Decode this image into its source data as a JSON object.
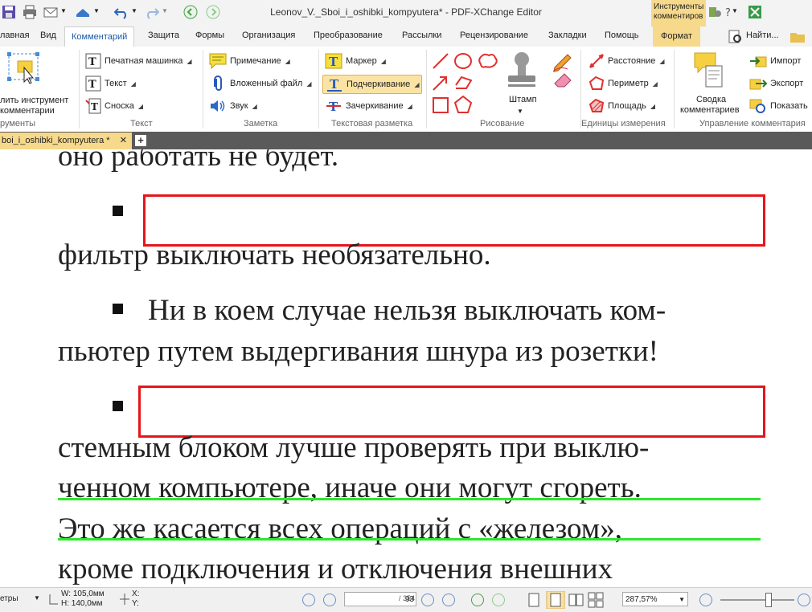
{
  "app": {
    "title": "Leonov_V._Sboi_i_oshibki_kompyutera* - PDF-XChange Editor",
    "context_tools_label": "Инструменты комментиров",
    "colors": {
      "accent": "#1a5aa8",
      "context_tab": "#f6d98a",
      "annotation_red": "#e5161b",
      "underline_green": "#2ee62e"
    }
  },
  "tabs": [
    {
      "label": "лавная"
    },
    {
      "label": "Вид"
    },
    {
      "label": "Комментарий"
    },
    {
      "label": "Защита"
    },
    {
      "label": "Формы"
    },
    {
      "label": "Организация"
    },
    {
      "label": "Преобразование"
    },
    {
      "label": "Рассылки"
    },
    {
      "label": "Рецензирование"
    },
    {
      "label": "Закладки"
    },
    {
      "label": "Помощь"
    },
    {
      "label": "Формат"
    },
    {
      "label": "Найти..."
    }
  ],
  "ribbon": {
    "tools": {
      "line1": "лить инструмент",
      "line2": "комментарии",
      "group": "рументы"
    },
    "text_group": {
      "typewriter": "Печатная машинка",
      "text": "Текст",
      "callout": "Сноска",
      "group": "Текст"
    },
    "note_group": {
      "note": "Примечание",
      "attached_file": "Вложенный файл",
      "sound": "Звук",
      "group": "Заметка"
    },
    "markup_group": {
      "highlight": "Маркер",
      "underline": "Подчеркивание",
      "strikeout": "Зачеркивание",
      "group": "Текстовая разметка"
    },
    "drawing_group": {
      "stamp": "Штамп",
      "group": "Рисование"
    },
    "measure_group": {
      "distance": "Расстояние",
      "perimeter": "Периметр",
      "area": "Площадь",
      "group": "Единицы измерения"
    },
    "manage_group": {
      "summary_line1": "Сводка",
      "summary_line2": "комментариев",
      "import": "Импорт",
      "export": "Экспорт",
      "show": "Показать",
      "group": "Управление комментария"
    }
  },
  "document_tab": {
    "label": "boi_i_oshibki_kompyutera *"
  },
  "document": {
    "lines": [
      "оно работать не будет.",
      "фильтр выключать необязательно.",
      "Ни в коем случае нельзя выключать ком-",
      "пьютер путем выдергивания шнура из розетки!",
      "стемным блоком лучше проверять при выклю-",
      "ченном компьютере, иначе они могут сгореть.",
      "Это же касается всех операций с «железом»,",
      "кроме подключения и отключения внешних"
    ]
  },
  "status": {
    "metrics_label": "етры",
    "width": "W: 105,0мм",
    "height": "H: 140,0мм",
    "x_label": "X:",
    "y_label": "Y:",
    "page_current": "93",
    "page_total": "/ 354",
    "zoom": "287,57%"
  }
}
